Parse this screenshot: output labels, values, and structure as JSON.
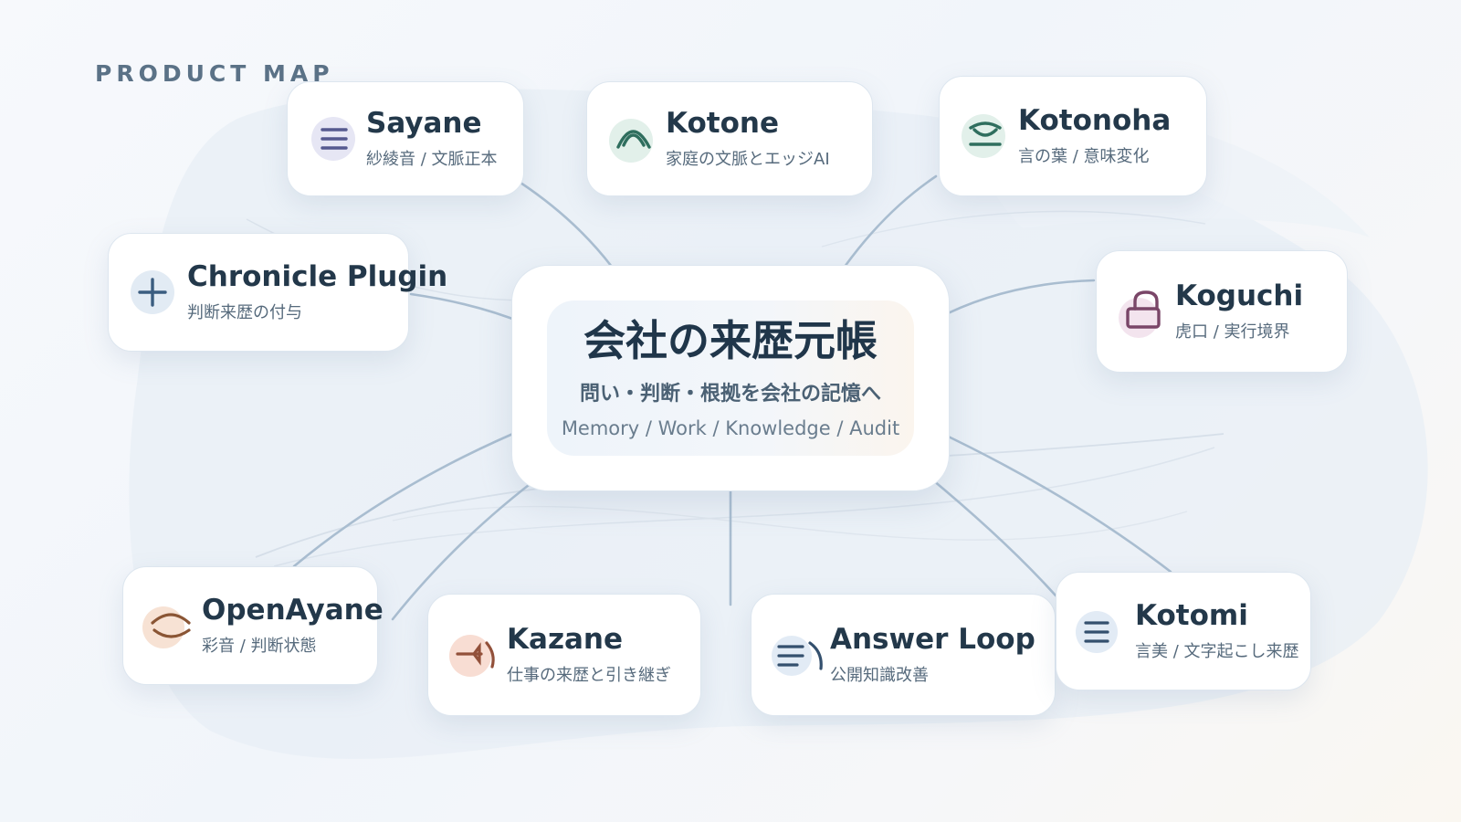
{
  "header": {
    "label": "PRODUCT MAP"
  },
  "center": {
    "title": "会社の来歴元帳",
    "subtitle": "問い・判断・根拠を会社の記憶へ",
    "tags": "Memory / Work / Knowledge / Audit"
  },
  "products": [
    {
      "id": "sayane",
      "name": "Sayane",
      "sub": "紗綾音 / 文脈正本",
      "icon": "lines-icon",
      "color": "#55598f",
      "bg": "#e6e6f4"
    },
    {
      "id": "kotone",
      "name": "Kotone",
      "sub": "家庭の文脈とエッジAI",
      "icon": "arch-icon",
      "color": "#2f6e5e",
      "bg": "#e2f0ea"
    },
    {
      "id": "kotonoha",
      "name": "Kotonoha",
      "sub": "言の葉 / 意味変化",
      "icon": "bridge-icon",
      "color": "#2f6e5e",
      "bg": "#e2f0ea"
    },
    {
      "id": "chronicle",
      "name": "Chronicle Plugin",
      "sub": "判断来歴の付与",
      "icon": "plus-icon",
      "color": "#3b5d80",
      "bg": "#e2ebf4"
    },
    {
      "id": "koguchi",
      "name": "Koguchi",
      "sub": "虎口 / 実行境界",
      "icon": "lock-icon",
      "color": "#7a4668",
      "bg": "#f3e4ee"
    },
    {
      "id": "openayane",
      "name": "OpenAyane",
      "sub": "彩音 / 判断状態",
      "icon": "eye-icon",
      "color": "#8a5534",
      "bg": "#f7e2d4"
    },
    {
      "id": "kazane",
      "name": "Kazane",
      "sub": "仕事の来歴と引き継ぎ",
      "icon": "wind-icon",
      "color": "#92503a",
      "bg": "#f8ddd3"
    },
    {
      "id": "answerloop",
      "name": "Answer Loop",
      "sub": "公開知識改善",
      "icon": "loop-icon",
      "color": "#34506e",
      "bg": "#e2ebf5"
    },
    {
      "id": "kotomi",
      "name": "Kotomi",
      "sub": "言美 / 文字起こし来歴",
      "icon": "lines-icon",
      "color": "#34506e",
      "bg": "#e2ebf5"
    }
  ]
}
